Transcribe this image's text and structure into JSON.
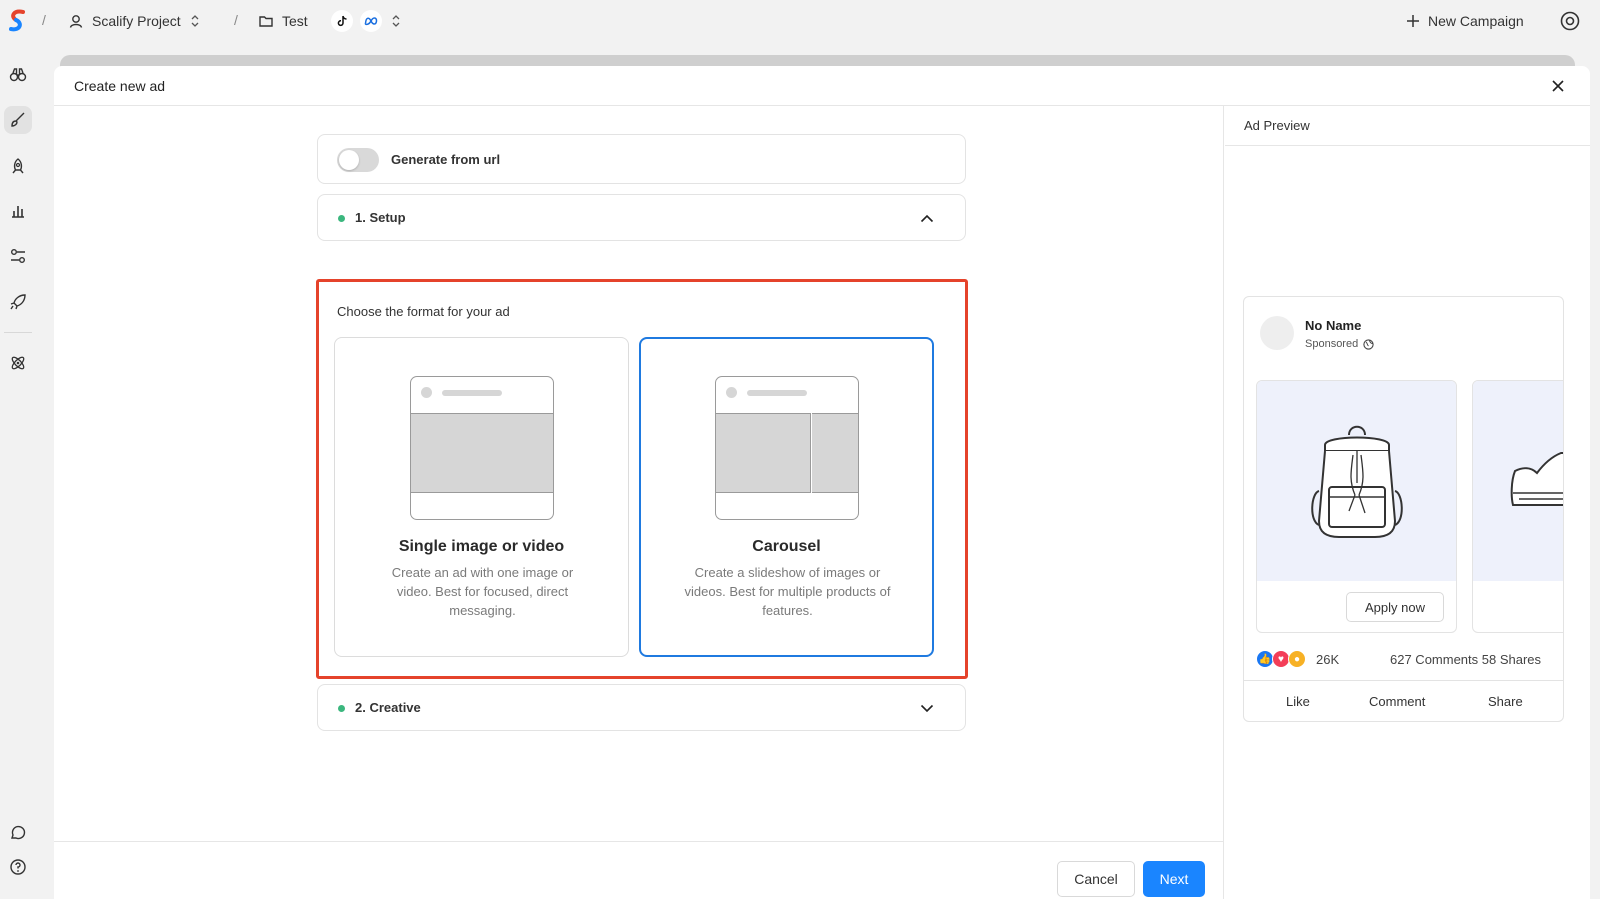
{
  "topbar": {
    "project_name": "Scalify Project",
    "folder_name": "Test",
    "new_campaign_label": "New Campaign",
    "separator": "/"
  },
  "modal": {
    "title": "Create new ad",
    "generate_from_url_label": "Generate from url",
    "generate_from_url_enabled": false,
    "setup_section_label": "1. Setup",
    "creative_section_label": "2. Creative",
    "format_prompt": "Choose the format for your ad",
    "formats": [
      {
        "title": "Single image or video",
        "description": "Create an ad with one image or video. Best for focused, direct messaging.",
        "selected": false
      },
      {
        "title": "Carousel",
        "description": "Create a slideshow of images or videos. Best for multiple products of features.",
        "selected": true
      }
    ],
    "cancel_label": "Cancel",
    "next_label": "Next"
  },
  "preview": {
    "title": "Ad Preview",
    "page_name": "No Name",
    "sponsored_label": "Sponsored",
    "cta_label": "Apply now",
    "reaction_count": "26K",
    "engagement": "627 Comments 58 Shares",
    "actions": {
      "like": "Like",
      "comment": "Comment",
      "share": "Share"
    }
  },
  "colors": {
    "accent": "#1a85ff",
    "selected_border": "#1f7ae0",
    "highlight_border": "#e5432b",
    "status_dot": "#3bb77e"
  },
  "icons": [
    "scalify-logo-icon",
    "user-icon",
    "updown-icon",
    "folder-icon",
    "tiktok-icon",
    "meta-icon",
    "plus-icon",
    "settings-icon",
    "binoculars-icon",
    "brush-icon",
    "rocket-icon",
    "chart-icon",
    "sliders-icon",
    "launch-icon",
    "atom-icon",
    "chat-icon",
    "help-icon",
    "close-icon",
    "chevron-up-icon",
    "chevron-down-icon",
    "globe-icon"
  ]
}
